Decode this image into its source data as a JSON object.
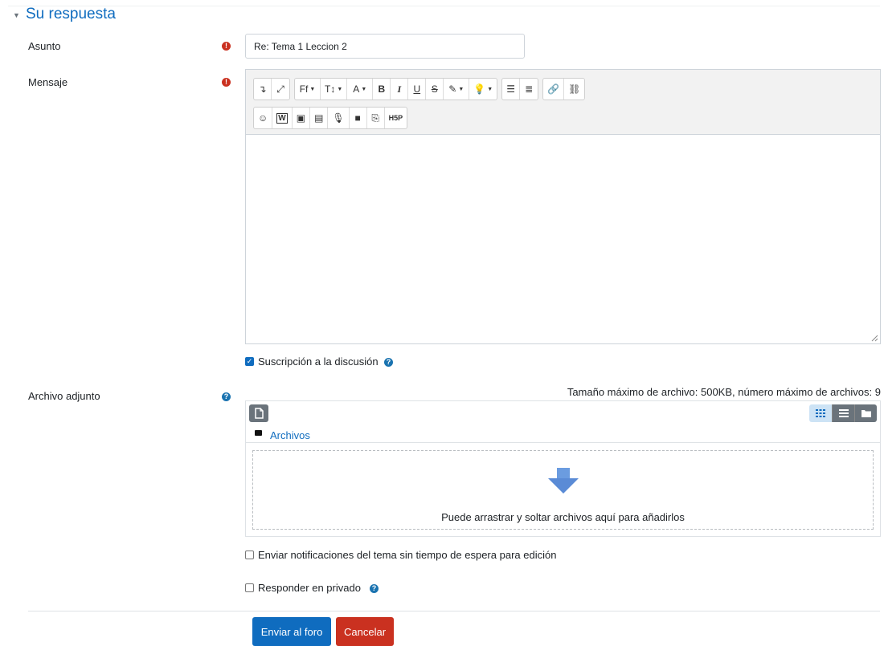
{
  "section": {
    "title": "Su respuesta",
    "collapse_glyph": "▼"
  },
  "subject": {
    "label": "Asunto",
    "value": "Re: Tema 1 Leccion 2",
    "required_glyph": "!"
  },
  "message": {
    "label": "Mensaje",
    "required_glyph": "!",
    "value": ""
  },
  "toolbar": {
    "row1": [
      [
        {
          "name": "collapse-toolbar-icon",
          "glyph": "↴"
        },
        {
          "name": "fullscreen-icon",
          "glyph": "⤢"
        }
      ],
      [
        {
          "name": "font-family-icon",
          "glyph": "Ff",
          "caret": true
        },
        {
          "name": "font-size-icon",
          "glyph": "T↕",
          "caret": true
        },
        {
          "name": "text-style-icon",
          "glyph": "A",
          "caret": true
        },
        {
          "name": "bold-icon",
          "glyph": "B"
        },
        {
          "name": "italic-icon",
          "glyph": "I"
        },
        {
          "name": "underline-icon",
          "glyph": "U"
        },
        {
          "name": "strikethrough-icon",
          "glyph": "S"
        },
        {
          "name": "color-brush-icon",
          "glyph": "✎",
          "caret": true
        },
        {
          "name": "lightbulb-icon",
          "glyph": "💡",
          "caret": true
        }
      ],
      [
        {
          "name": "unordered-list-icon",
          "glyph": "☰"
        },
        {
          "name": "ordered-list-icon",
          "glyph": "≣"
        }
      ],
      [
        {
          "name": "link-icon",
          "glyph": "🔗"
        },
        {
          "name": "unlink-icon",
          "glyph": "⛓"
        }
      ]
    ],
    "row2": [
      [
        {
          "name": "emoji-icon",
          "glyph": "☺"
        },
        {
          "name": "word-paste-icon",
          "glyph": "W"
        },
        {
          "name": "image-icon",
          "glyph": "▣"
        },
        {
          "name": "media-file-icon",
          "glyph": "▤"
        },
        {
          "name": "microphone-icon",
          "glyph": "🎙"
        },
        {
          "name": "video-camera-icon",
          "glyph": "■"
        },
        {
          "name": "copy-icon",
          "glyph": "⎘"
        },
        {
          "name": "h5p-icon",
          "glyph": "H5P"
        }
      ]
    ]
  },
  "subscription": {
    "label": "Suscripción a la discusión",
    "checked": true
  },
  "attachment": {
    "label": "Archivo adjunto",
    "info": "Tamaño máximo de archivo: 500KB, número máximo de archivos: 9",
    "folder_link": "Archivos",
    "drop_text": "Puede arrastrar y soltar archivos aquí para añadirlos"
  },
  "notify": {
    "label": "Enviar notificaciones del tema sin tiempo de espera para edición",
    "checked": false
  },
  "private_reply": {
    "label": "Responder en privado",
    "checked": false
  },
  "buttons": {
    "submit": "Enviar al foro",
    "cancel": "Cancelar"
  },
  "help_glyph": "?",
  "colors": {
    "accent": "#0f6cbf",
    "danger": "#ca3120",
    "help": "#1a73b0"
  }
}
